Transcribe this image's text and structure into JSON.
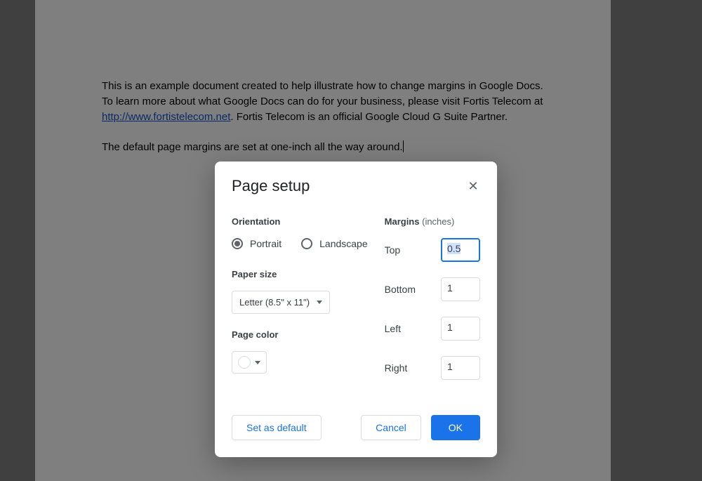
{
  "document": {
    "paragraph1_pre": "This is an example document created to help illustrate how to change margins in Google Docs. To learn more about what Google Docs can do for your business, please visit Fortis Telecom at ",
    "link_text": "http://www.fortistelecom.net",
    "paragraph1_post": ". Fortis Telecom is an official Google Cloud G Suite Partner.",
    "paragraph2": "The default page margins are set at one-inch all the way around."
  },
  "dialog": {
    "title": "Page setup",
    "orientation": {
      "label": "Orientation",
      "portrait": "Portrait",
      "landscape": "Landscape",
      "selected": "Portrait"
    },
    "paper_size": {
      "label": "Paper size",
      "value": "Letter (8.5\" x 11\")"
    },
    "page_color": {
      "label": "Page color",
      "value": "#ffffff"
    },
    "margins": {
      "label": "Margins",
      "unit": "(inches)",
      "rows": [
        {
          "label": "Top",
          "value": "0.5",
          "focused": true
        },
        {
          "label": "Bottom",
          "value": "1",
          "focused": false
        },
        {
          "label": "Left",
          "value": "1",
          "focused": false
        },
        {
          "label": "Right",
          "value": "1",
          "focused": false
        }
      ]
    },
    "buttons": {
      "set_default": "Set as default",
      "cancel": "Cancel",
      "ok": "OK"
    }
  }
}
